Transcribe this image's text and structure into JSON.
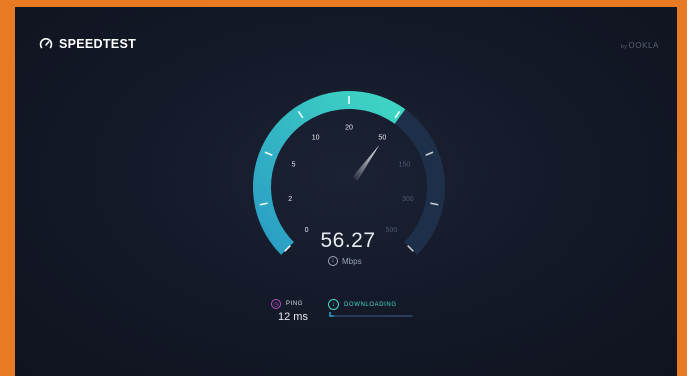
{
  "app": {
    "brand": "SPEEDTEST",
    "powered_by_prefix": "by",
    "powered_by": "OOKLA"
  },
  "gauge": {
    "ticks": [
      {
        "label": "0",
        "value": 0
      },
      {
        "label": "2",
        "value": 2
      },
      {
        "label": "5",
        "value": 5
      },
      {
        "label": "10",
        "value": 10
      },
      {
        "label": "20",
        "value": 20
      },
      {
        "label": "50",
        "value": 50
      },
      {
        "label": "150",
        "value": 150
      },
      {
        "label": "300",
        "value": 300
      },
      {
        "label": "500",
        "value": 500
      }
    ],
    "speed_value": "56.27",
    "speed_numeric": 56.27,
    "unit": "Mbps",
    "colors": {
      "track": "#1e3049",
      "fill_start": "#2a9cc4",
      "fill_end": "#3fd7c3",
      "needle": "#ffffff"
    }
  },
  "ping": {
    "label": "PING",
    "value": "12 ms"
  },
  "download": {
    "label": "DOWNLOADING",
    "progress_fraction": 0.06
  }
}
